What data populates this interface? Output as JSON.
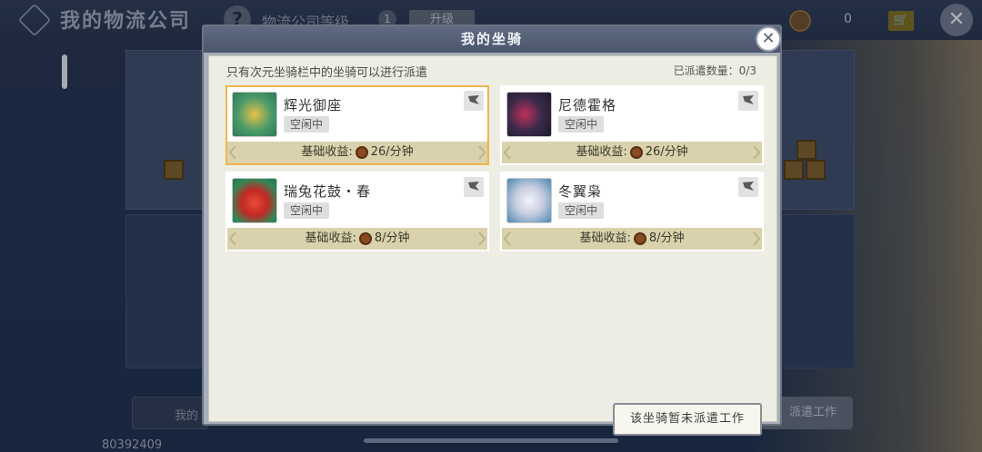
{
  "background": {
    "title": "我的物流公司",
    "level_label": "物流公司等级",
    "level_value": "1",
    "upgrade_label": "升级",
    "coin_count": "0",
    "bottom_left_label": "我的",
    "bottom_right_label": "派遣工作",
    "user_id": "80392409"
  },
  "modal": {
    "title": "我的坐骑",
    "hint": "只有次元坐骑栏中的坐骑可以进行派遣",
    "dispatch_count": "已派遣数量：0/3",
    "status_button": "该坐骑暂未派遣工作"
  },
  "mounts": [
    {
      "name": "辉光御座",
      "status": "空闲中",
      "income_label": "基础收益:",
      "income_value": "26/分钟",
      "selected": true
    },
    {
      "name": "尼德霍格",
      "status": "空闲中",
      "income_label": "基础收益:",
      "income_value": "26/分钟",
      "selected": false
    },
    {
      "name": "瑞兔花鼓・春",
      "status": "空闲中",
      "income_label": "基础收益:",
      "income_value": "8/分钟",
      "selected": false
    },
    {
      "name": "冬翼枭",
      "status": "空闲中",
      "income_label": "基础收益:",
      "income_value": "8/分钟",
      "selected": false
    }
  ],
  "colors": {
    "selected_border": "#f0b54a",
    "income_bar": "#d9d2ad",
    "modal_header": "#5f6b82"
  }
}
